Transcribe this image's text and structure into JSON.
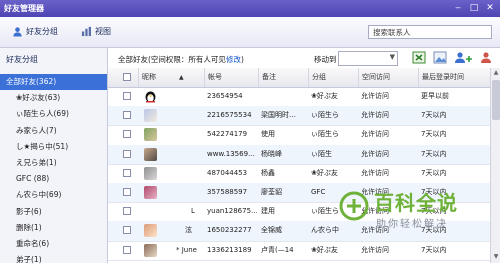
{
  "window": {
    "title": "好友管理器"
  },
  "toolbar": {
    "friend_group_label": "好友分组",
    "view_label": "视图",
    "search_placeholder": "搜索联系人"
  },
  "sidebar": {
    "header": "好友分组",
    "groups": [
      "全部好友(362)",
      "❀好ぷ友(63)",
      "ぃ陌生ら人(69)",
      "み家ら人(7)",
      "し★揭ら中(51)",
      "え兄ら弟(1)",
      "GFC (88)",
      "ん农ら中(69)",
      "影子(6)",
      "删除(1)",
      "重命名(6)",
      "弟子(1)"
    ],
    "selected_index": 0
  },
  "main": {
    "info_prefix": "全部好友(空间权限：所有人可见",
    "info_link": "修改",
    "info_suffix": ")",
    "move_to_label": "移动到",
    "columns": [
      "昵称",
      "帐号",
      "备注",
      "分组",
      "空间访问",
      "最后登录时间"
    ],
    "rows": [
      {
        "nick": "",
        "account": "23654954",
        "remark": "",
        "group": "❀好ぷ友",
        "access": "允许访问",
        "login": "更早以前"
      },
      {
        "nick": "",
        "account": "2216575534",
        "remark": "梁国明时…",
        "group": "ぃ陌生ら",
        "access": "允许访问",
        "login": "7天以内"
      },
      {
        "nick": "",
        "account": "542274179",
        "remark": "使用",
        "group": "ぃ陌生ら",
        "access": "允许访问",
        "login": "7天以内"
      },
      {
        "nick": "",
        "account": "www.13569…",
        "remark": "杨晓峰",
        "group": "ぃ陌生",
        "access": "允许访问",
        "login": "7天以内"
      },
      {
        "nick": "",
        "account": "487044453",
        "remark": "杨鑫",
        "group": "❀好ぷ友",
        "access": "允许访问",
        "login": "7天以内"
      },
      {
        "nick": "",
        "account": "357588597",
        "remark": "廖荃貂",
        "group": "GFC",
        "access": "允许访问",
        "login": "7天以内"
      },
      {
        "nick": "L",
        "account": "yuan128675…",
        "remark": "建用",
        "group": "ぃ陌生ら",
        "access": "允许访问",
        "login": "7天以内"
      },
      {
        "nick": "泫",
        "account": "1650232277",
        "remark": "全锦威",
        "group": "ん农ら中",
        "access": "允许访问",
        "login": "7天以内"
      },
      {
        "nick": "* June",
        "account": "1336213189",
        "remark": "卢青(—14",
        "group": "❀好ぷ友",
        "access": "允许访问",
        "login": "7天以内"
      }
    ]
  },
  "watermark": {
    "title": "百科全说",
    "subtitle": "助你轻松解决"
  },
  "colors": {
    "titlebar": "#5a51bf",
    "selection": "#3a70d8",
    "accent_green": "#6fb23a"
  }
}
